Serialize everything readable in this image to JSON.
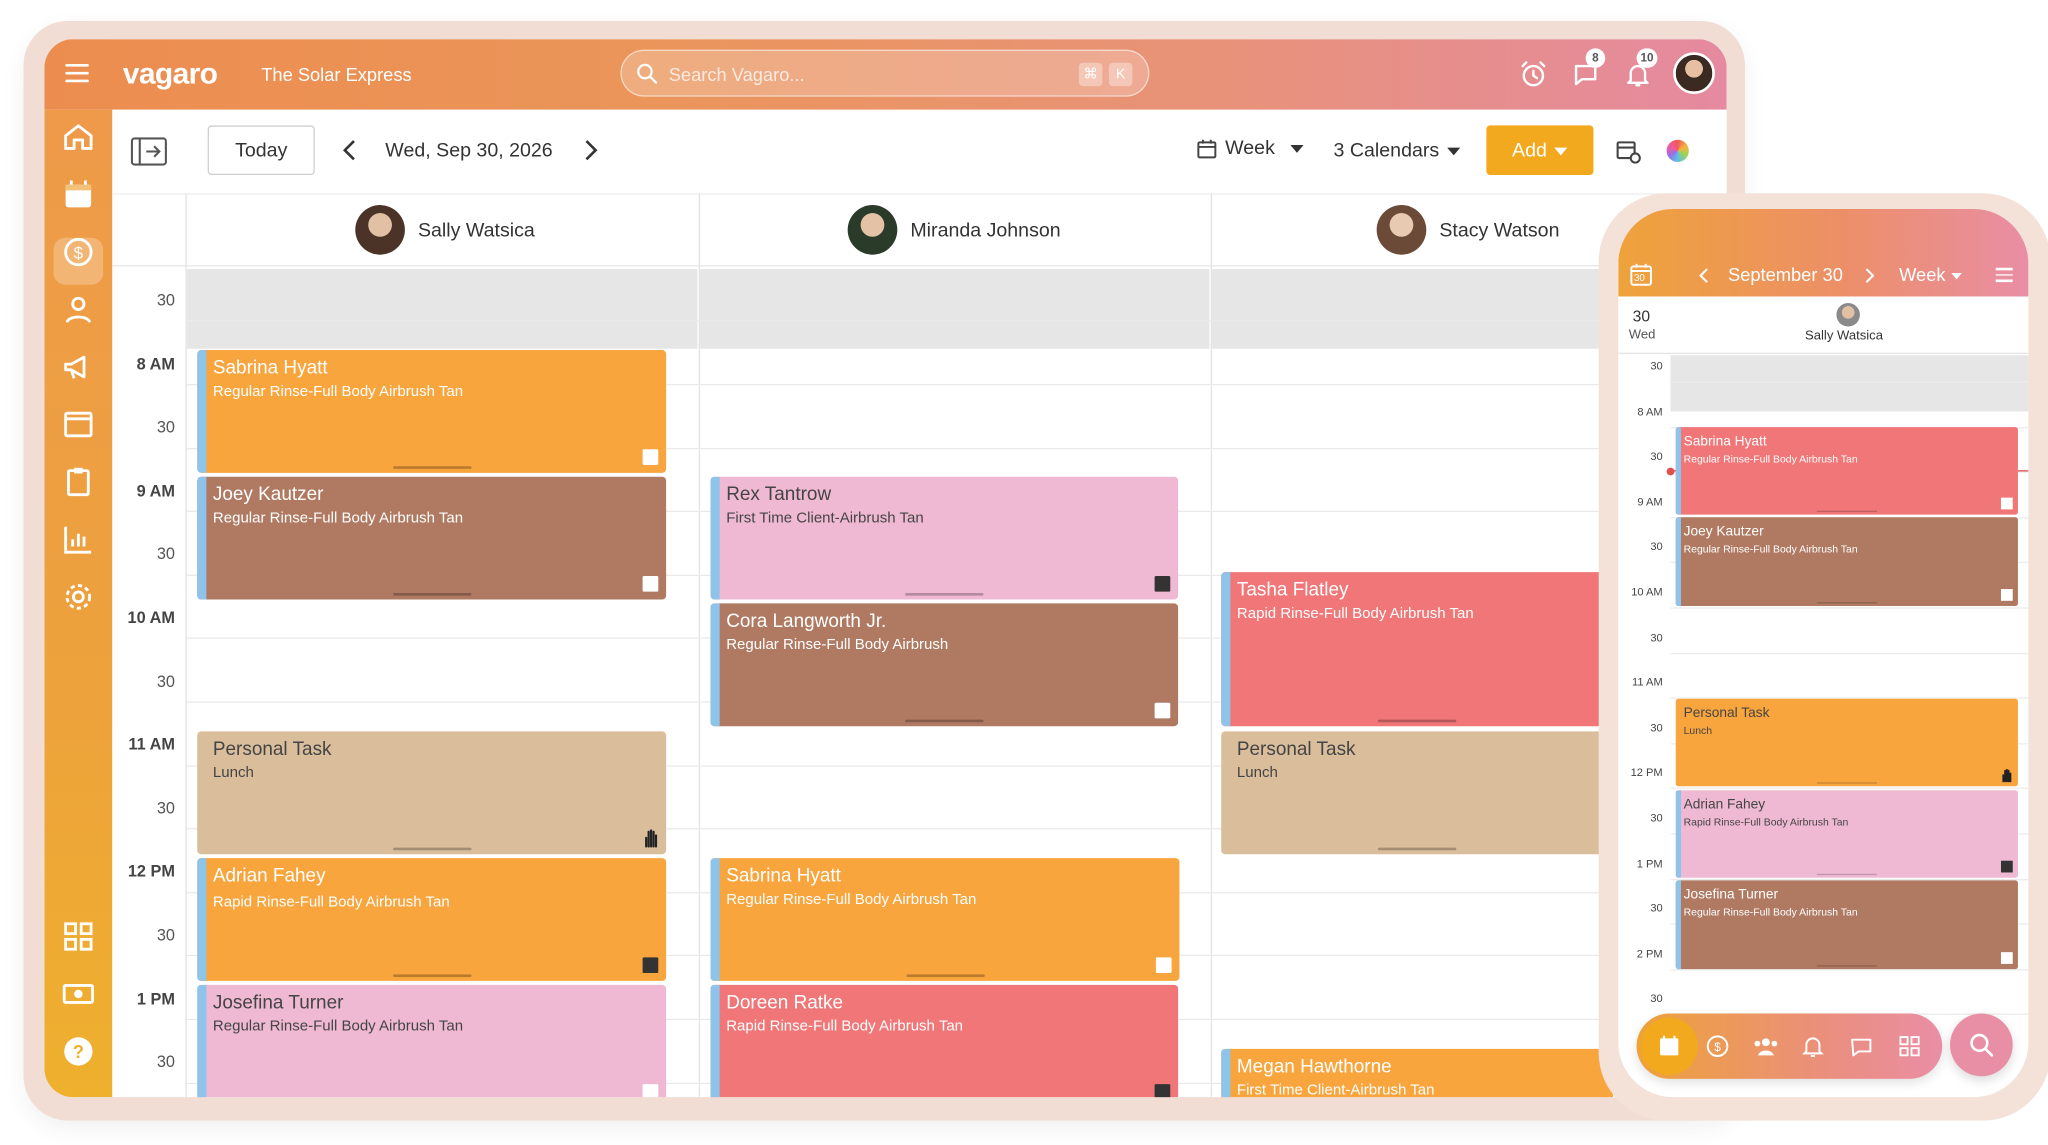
{
  "app": {
    "logo": "vagaro",
    "business": "The Solar Express"
  },
  "search": {
    "placeholder": "Search Vagaro...",
    "shortcut_1": "⌘",
    "shortcut_2": "K"
  },
  "notifications": {
    "messages_count": "8",
    "alerts_count": "10"
  },
  "toolbar": {
    "today_label": "Today",
    "date_label": "Wed, Sep 30, 2026",
    "view_label": "Week",
    "calendars_label": "3 Calendars",
    "add_label": "Add"
  },
  "staff": [
    {
      "name": "Sally Watsica"
    },
    {
      "name": "Miranda Johnson"
    },
    {
      "name": "Stacy Watson"
    }
  ],
  "time_labels": [
    "30",
    "8 AM",
    "30",
    "9 AM",
    "30",
    "10 AM",
    "30",
    "11 AM",
    "30",
    "12 PM",
    "30",
    "1 PM",
    "30"
  ],
  "appointments": {
    "sally": [
      {
        "name": "Sabrina Hyatt",
        "service": "Regular Rinse-Full Body Airbrush Tan"
      },
      {
        "name": "Joey Kautzer",
        "service": "Regular Rinse-Full Body Airbrush Tan"
      },
      {
        "name": "Personal Task",
        "service": "Lunch"
      },
      {
        "name": "Adrian Fahey",
        "service": "Rapid Rinse-Full Body Airbrush Tan"
      },
      {
        "name": "Josefina Turner",
        "service": "Regular Rinse-Full Body Airbrush Tan"
      }
    ],
    "miranda": [
      {
        "name": "Rex Tantrow",
        "service": "First Time Client-Airbrush Tan"
      },
      {
        "name": "Cora Langworth Jr.",
        "service": "Regular Rinse-Full Body Airbrush"
      },
      {
        "name": "Sabrina Hyatt",
        "service": "Regular Rinse-Full Body Airbrush Tan"
      },
      {
        "name": "Doreen Ratke",
        "service": "Rapid Rinse-Full Body Airbrush Tan"
      }
    ],
    "stacy": [
      {
        "name": "Tasha Flatley",
        "service": "Rapid Rinse-Full Body Airbrush Tan"
      },
      {
        "name": "Personal Task",
        "service": "Lunch"
      },
      {
        "name": "Megan Hawthorne",
        "service": "First Time Client-Airbrush Tan"
      }
    ]
  },
  "mobile": {
    "date_label": "September 30",
    "view_label": "Week",
    "day_number": "30",
    "day_name": "Wed",
    "calendar_icon_day": "30",
    "staff_name": "Sally Watsica",
    "time_labels": [
      "30",
      "8 AM",
      "30",
      "9 AM",
      "30",
      "10 AM",
      "30",
      "11 AM",
      "30",
      "12 PM",
      "30",
      "1 PM",
      "30",
      "2 PM",
      "30"
    ],
    "appointments": [
      {
        "name": "Sabrina Hyatt",
        "service": "Regular Rinse-Full Body Airbrush Tan"
      },
      {
        "name": "Joey Kautzer",
        "service": "Regular Rinse-Full Body Airbrush Tan"
      },
      {
        "name": "Personal Task",
        "service": "Lunch"
      },
      {
        "name": "Adrian Fahey",
        "service": "Rapid Rinse-Full Body Airbrush Tan"
      },
      {
        "name": "Josefina Turner",
        "service": "Regular Rinse-Full Body Airbrush Tan"
      }
    ]
  },
  "colors": {
    "accent": "#f2a91d",
    "orange": "#f9a53e",
    "brown": "#b07a62",
    "pink": "#efb9d4",
    "red": "#f07678",
    "tan": "#dabe9b"
  },
  "icons": {
    "sidebar": [
      "home-icon",
      "calendar-icon",
      "dollar-icon",
      "user-icon",
      "megaphone-icon",
      "window-icon",
      "clipboard-icon",
      "bar-chart-icon",
      "gear-icon",
      "apps-icon",
      "money-icon",
      "help-icon"
    ],
    "topbar": [
      "alarm-clock-icon",
      "chat-icon",
      "bell-icon"
    ],
    "mobile_nav": [
      "calendar-icon",
      "dollar-icon",
      "users-icon",
      "bell-icon",
      "chat-icon",
      "apps-icon",
      "search-icon"
    ]
  }
}
